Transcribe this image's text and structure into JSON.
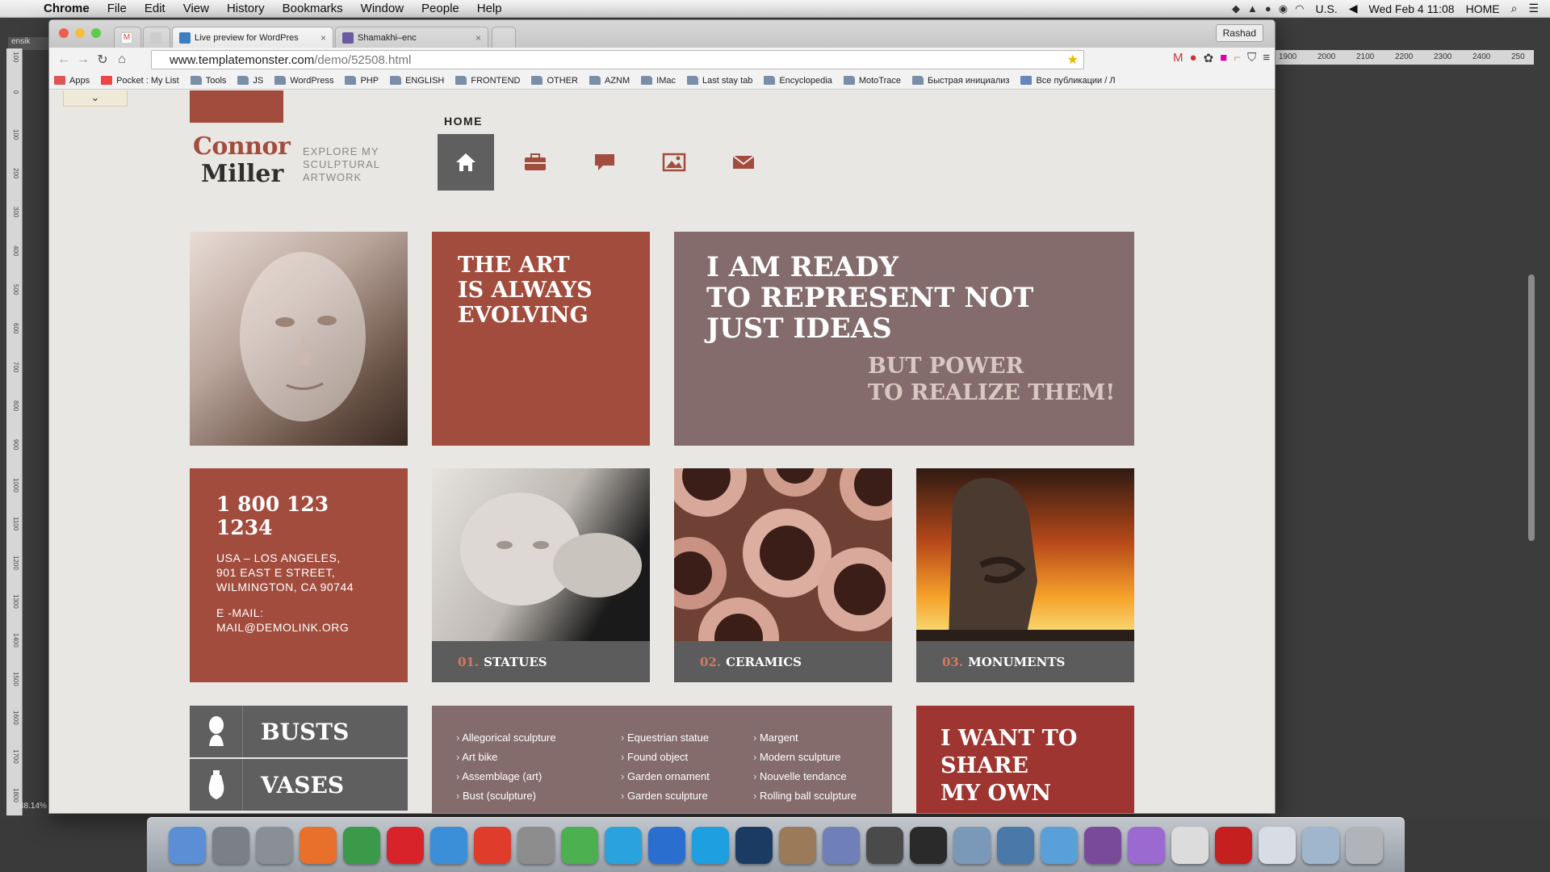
{
  "menubar": {
    "items": [
      "Chrome",
      "File",
      "Edit",
      "View",
      "History",
      "Bookmarks",
      "Window",
      "People",
      "Help"
    ],
    "input_source": "U.S.",
    "clock": "Wed Feb 4  11:08",
    "home_label": "HOME"
  },
  "photoshop": {
    "doc_tab": "ensik",
    "zoom": "48.14%",
    "ruler_top": [
      "1900",
      "2000",
      "2100",
      "2200",
      "2300",
      "2400",
      "250"
    ],
    "ruler_left": [
      "100",
      "0",
      "100",
      "200",
      "300",
      "400",
      "500",
      "600",
      "700",
      "800",
      "900",
      "1000",
      "1100",
      "1200",
      "1300",
      "1400",
      "1500",
      "1600",
      "1700",
      "1800"
    ]
  },
  "browser": {
    "tabs": [
      {
        "label": "Live preview for WordPres",
        "close": "×"
      },
      {
        "label": "Shamakhi–enc",
        "close": "×"
      }
    ],
    "user": "Rashad",
    "url_host": "www.templatemonster.com",
    "url_path": "/demo/52508.html",
    "bookmarks": [
      "Apps",
      "Pocket : My List",
      "Tools",
      "JS",
      "WordPress",
      "PHP",
      "ENGLISH",
      "FRONTEND",
      "OTHER",
      "AZNM",
      "IMac",
      "Last stay tab",
      "Encyclopedia",
      "MotoTrace",
      "Быстрая инициализ",
      "Все публикации / Л"
    ]
  },
  "site": {
    "logo_first": "Connor",
    "logo_last": "Miller",
    "tagline": "EXPLORE MY SCULPTURAL ARTWORK",
    "nav_active": "HOME",
    "nav_icons": [
      "home-icon",
      "briefcase-icon",
      "chat-icon",
      "gallery-icon",
      "mail-icon"
    ],
    "art_tile": "THE ART IS ALWAYS EVOLVING",
    "ready_tile": {
      "lines": [
        "I AM READY",
        "TO REPRESENT NOT",
        "JUST IDEAS"
      ],
      "sub": [
        "BUT POWER",
        "TO REALIZE THEM!"
      ]
    },
    "contact": {
      "phone": "1 800 123 1234",
      "address": [
        "USA – LOS ANGELES,",
        "901 EAST E STREET,",
        "WILMINGTON, CA 90744"
      ],
      "email_label": "E -MAIL:",
      "email": "MAIL@DEMOLINK.ORG"
    },
    "categories": [
      {
        "num": "01.",
        "name": "STATUES"
      },
      {
        "num": "02.",
        "name": "CERAMICS"
      },
      {
        "num": "03.",
        "name": "MONUMENTS"
      }
    ],
    "side_cats": [
      "BUSTS",
      "VASES"
    ],
    "list_cols": [
      [
        "Allegorical sculpture",
        "Art bike",
        "Assemblage (art)",
        "Bust (sculpture)"
      ],
      [
        "Equestrian statue",
        "Found object",
        "Garden ornament",
        "Garden sculpture"
      ],
      [
        "Margent",
        "Modern sculpture",
        "Nouvelle tendance",
        "Rolling ball sculpture"
      ]
    ],
    "share_tile": [
      "I WANT TO",
      "SHARE",
      "MY OWN"
    ]
  },
  "colors": {
    "brick": "#a24c3d",
    "mauve": "#846c6c",
    "gray": "#5c5c5c",
    "red": "#9e3530"
  },
  "dock": [
    "finder",
    "launchpad",
    "system-preferences",
    "firefox",
    "chrome",
    "opera",
    "safari",
    "yandex",
    "calculator",
    "evernote",
    "telegram",
    "teamviewer",
    "skype",
    "photoshop",
    "preview",
    "php",
    "sublime",
    "terminal",
    "mysql",
    "mysql-workbench",
    "wunderlist",
    "github",
    "ftp",
    "textedit",
    "filezilla",
    "desktop",
    "downloads",
    "trash"
  ]
}
